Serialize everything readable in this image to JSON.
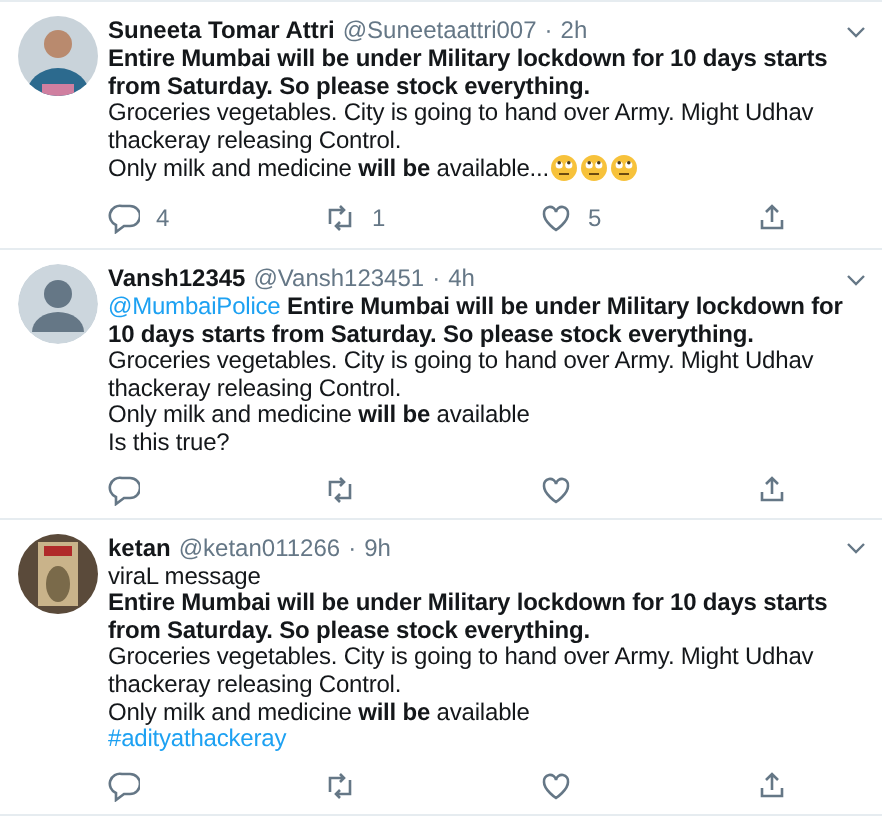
{
  "tweets": [
    {
      "avatar": {
        "kind": "picture"
      },
      "name": "Suneeta Tomar Attri",
      "handle": "@Suneetaattri007",
      "separator": "·",
      "time": "2h",
      "paragraphs": [
        {
          "kind": "bold",
          "text": "Entire Mumbai will be under Military lockdown for 10 days starts from Saturday. So please stock everything."
        },
        {
          "kind": "plain",
          "text": "Groceries vegetables. City is going to hand over Army. Might Udhav thackeray releasing Control."
        },
        {
          "kind": "plain",
          "text": "Only milk and medicine **will be** available...",
          "emojis": [
            {
              "kind": "rolling-eyes"
            },
            {
              "kind": "rolling-eyes"
            },
            {
              "kind": "rolling-eyes"
            }
          ]
        }
      ],
      "replies": "4",
      "retweets": "1",
      "likes": "5"
    },
    {
      "avatar": {
        "kind": "silhouette"
      },
      "name": "Vansh12345",
      "handle": "@Vansh123451",
      "separator": "·",
      "time": "4h",
      "paragraphs": [
        {
          "kind": "plain",
          "mention": "@MumbaiPolice",
          "text": "**Entire Mumbai will be under Military lockdown for 10 days starts from Saturday. So please stock everything.**"
        },
        {
          "kind": "plain",
          "text": "Groceries vegetables. City is going to hand over Army. Might Udhav thackeray releasing Control."
        },
        {
          "kind": "plain",
          "text": "Only milk and medicine **will be** available"
        },
        {
          "kind": "plain",
          "text": "Is this true?"
        }
      ]
    },
    {
      "avatar": {
        "kind": "picture"
      },
      "name": "ketan",
      "handle": "@ketan011266",
      "separator": "·",
      "time": "9h",
      "paragraphs": [
        {
          "kind": "plain",
          "text": "viraL message"
        },
        {
          "kind": "bold",
          "text": "Entire Mumbai will be under Military lockdown for 10 days starts from Saturday. So please stock everything."
        },
        {
          "kind": "plain",
          "text": "Groceries vegetables. City is going to hand over Army. Might Udhav thackeray releasing Control."
        },
        {
          "kind": "plain",
          "text": "Only milk and medicine **will be** available"
        },
        {
          "kind": "hashtag",
          "text": "#adityathackeray"
        }
      ]
    }
  ]
}
